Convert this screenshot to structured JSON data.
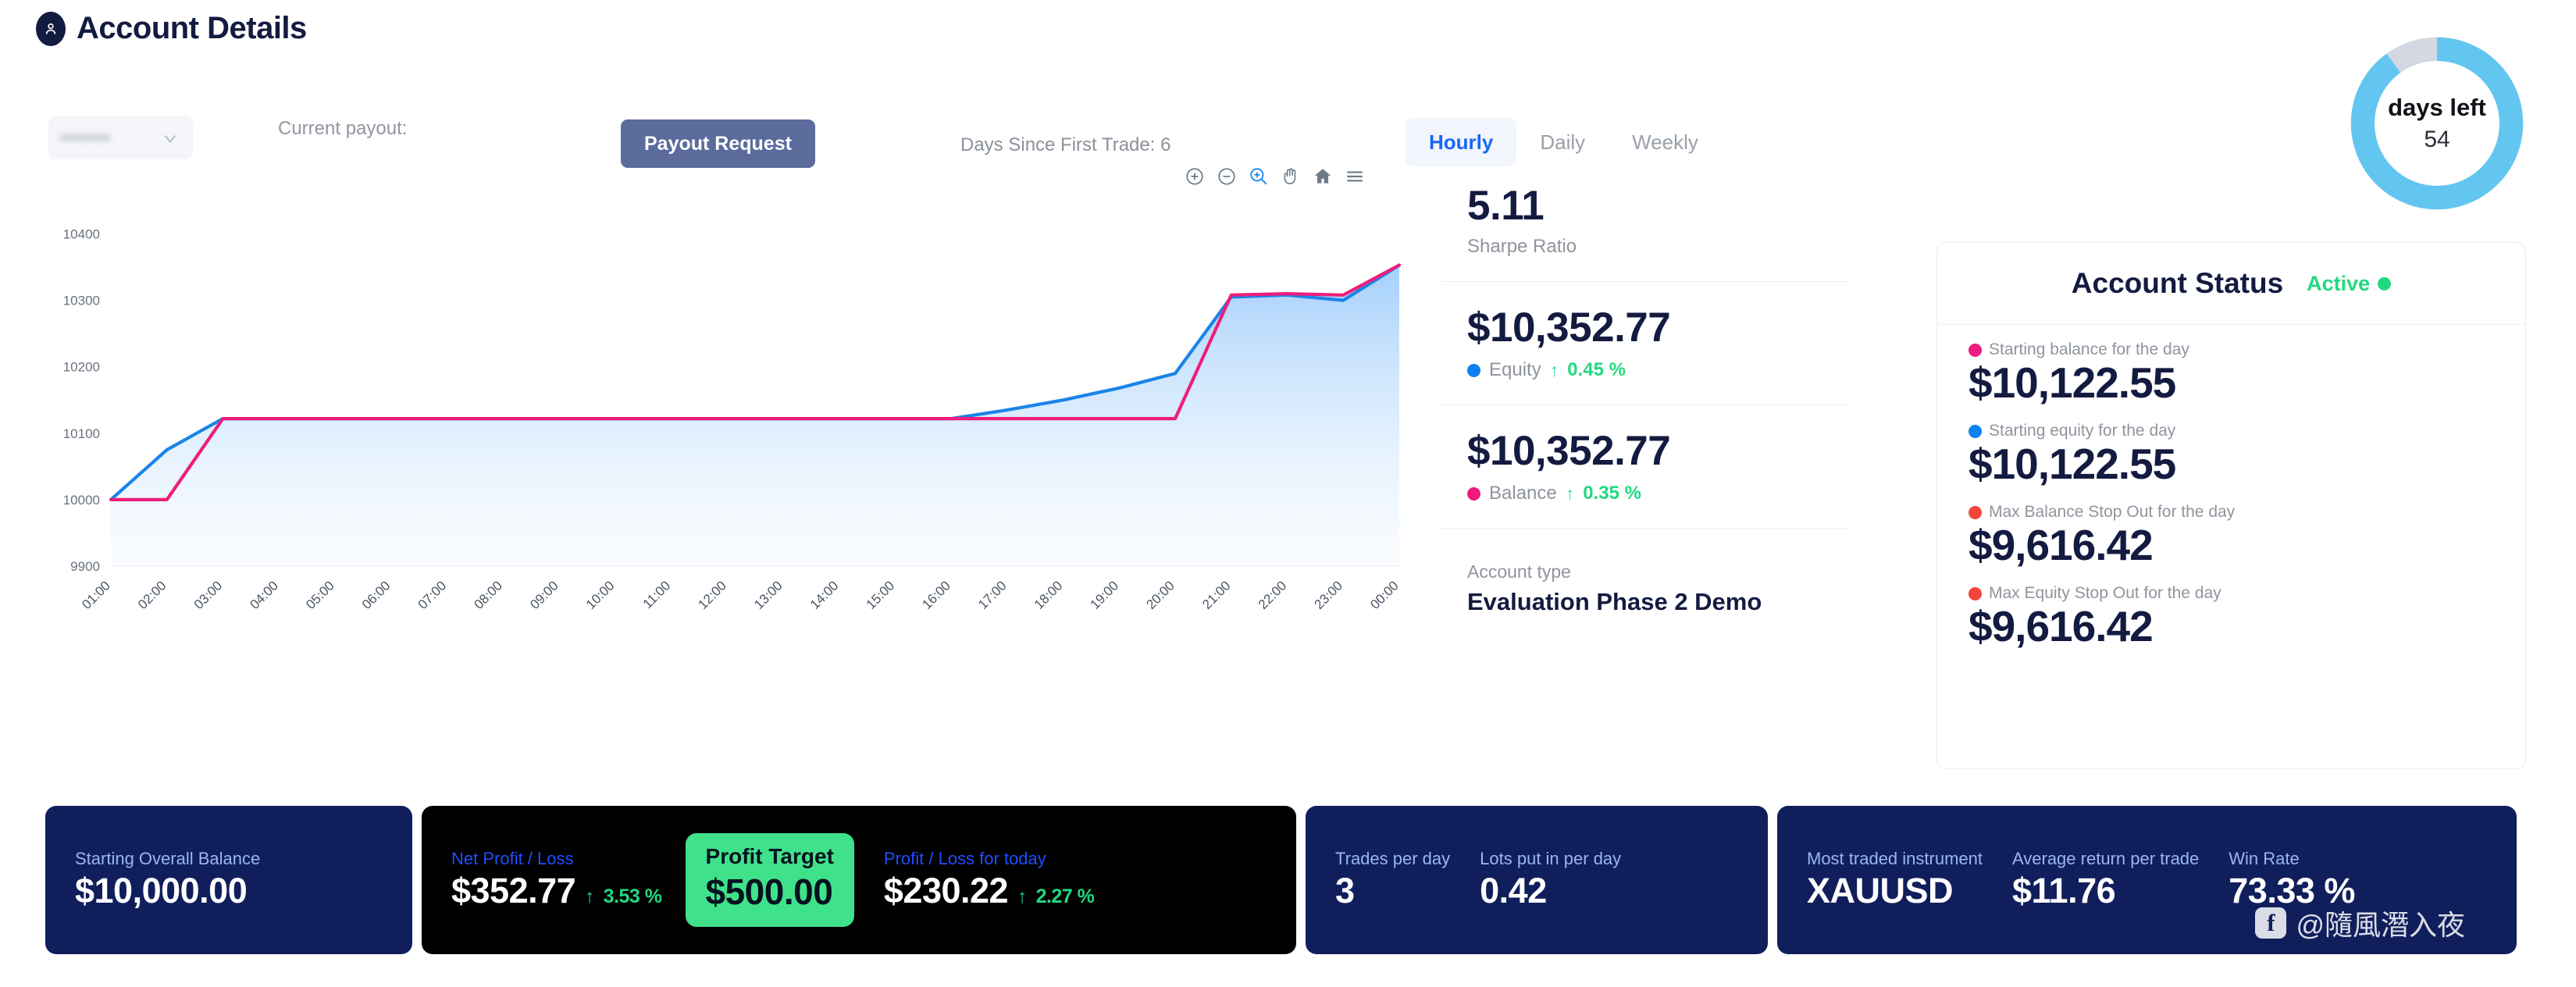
{
  "header": {
    "title": "Account Details",
    "avatar_icon": "user-icon"
  },
  "toolbar": {
    "account_select_value": "•••••••",
    "chevron_icon": "chevron-down-icon",
    "current_payout_label": "Current payout:",
    "payout_button": "Payout Request",
    "days_since_first_trade": "Days Since First Trade: 6",
    "tabs": [
      {
        "label": "Hourly",
        "active": true
      },
      {
        "label": "Daily",
        "active": false
      },
      {
        "label": "Weekly",
        "active": false
      }
    ]
  },
  "days_left_gauge": {
    "title": "days left",
    "value": "54",
    "percent_filled": 90,
    "track_color": "#d3d8e2",
    "fill_color": "#63c6f0"
  },
  "chart_toolbar": {
    "icons": [
      "zoom-in-icon",
      "zoom-out-icon",
      "selection-zoom-icon",
      "pan-icon",
      "reset-zoom-icon",
      "menu-icon"
    ]
  },
  "chart_data": {
    "type": "area",
    "title": "",
    "xlabel": "",
    "ylabel": "",
    "ylim": [
      9900,
      10450
    ],
    "yticks": [
      9900,
      10000,
      10100,
      10200,
      10300,
      10400
    ],
    "grid": false,
    "legend": "none",
    "x": [
      "01:00",
      "02:00",
      "03:00",
      "04:00",
      "05:00",
      "06:00",
      "07:00",
      "08:00",
      "09:00",
      "10:00",
      "11:00",
      "12:00",
      "13:00",
      "14:00",
      "15:00",
      "16:00",
      "17:00",
      "18:00",
      "19:00",
      "20:00",
      "21:00",
      "22:00",
      "23:00",
      "00:00"
    ],
    "series": [
      {
        "name": "Equity",
        "color": "#1b84e8",
        "values": [
          10000,
          10075,
          10122,
          10122,
          10122,
          10122,
          10122,
          10122,
          10122,
          10122,
          10122,
          10122,
          10122,
          10122,
          10122,
          10122,
          10135,
          10150,
          10168,
          10190,
          10305,
          10308,
          10300,
          10353
        ]
      },
      {
        "name": "Balance",
        "color": "#ed1e79",
        "values": [
          10000,
          10000,
          10122,
          10122,
          10122,
          10122,
          10122,
          10122,
          10122,
          10122,
          10122,
          10122,
          10122,
          10122,
          10122,
          10122,
          10122,
          10122,
          10122,
          10122,
          10308,
          10310,
          10308,
          10353
        ]
      }
    ]
  },
  "stats": {
    "sharpe": {
      "value": "5.11",
      "label": "Sharpe Ratio"
    },
    "equity": {
      "value": "$10,352.77",
      "name": "Equity",
      "arrow": "↑",
      "pct": "0.45 %",
      "dot_color": "#0b82f0"
    },
    "balance": {
      "value": "$10,352.77",
      "name": "Balance",
      "arrow": "↑",
      "pct": "0.35 %",
      "dot_color": "#ee1a7f"
    },
    "account_type": {
      "label": "Account type",
      "value": "Evaluation Phase 2 Demo"
    }
  },
  "account_status": {
    "title": "Account Status",
    "state": "Active",
    "state_color": "#22d97f",
    "rows": [
      {
        "label": "Starting balance for the day",
        "value": "$10,122.55",
        "dot_color": "#ee1a7f"
      },
      {
        "label": "Starting equity for the day",
        "value": "$10,122.55",
        "dot_color": "#0b82f0"
      },
      {
        "label": "Max Balance Stop Out for the day",
        "value": "$9,616.42",
        "dot_color": "#f4453c"
      },
      {
        "label": "Max Equity Stop Out for the day",
        "value": "$9,616.42",
        "dot_color": "#f4453c"
      }
    ]
  },
  "bottom_cards": {
    "starting_overall_balance": {
      "label": "Starting Overall Balance",
      "value": "$10,000.00"
    },
    "net_profit_loss": {
      "label": "Net Profit / Loss",
      "value": "$352.77",
      "arrow": "↑",
      "pct": "3.53 %"
    },
    "profit_target": {
      "label": "Profit Target",
      "value": "$500.00"
    },
    "profit_loss_today": {
      "label": "Profit / Loss for today",
      "value": "$230.22",
      "arrow": "↑",
      "pct": "2.27 %"
    },
    "trades_per_day": {
      "label": "Trades per day",
      "value": "3"
    },
    "lots_per_day": {
      "label": "Lots put in per day",
      "value": "0.42"
    },
    "most_traded_instrument": {
      "label": "Most traded instrument",
      "value": "XAUUSD"
    },
    "average_return_per_trade": {
      "label": "Average return per trade",
      "value": "$11.76"
    },
    "win_rate": {
      "label": "Win Rate",
      "value": "73.33 %"
    }
  },
  "watermark": {
    "icon": "facebook-icon",
    "text": "@隨風潛入夜"
  }
}
